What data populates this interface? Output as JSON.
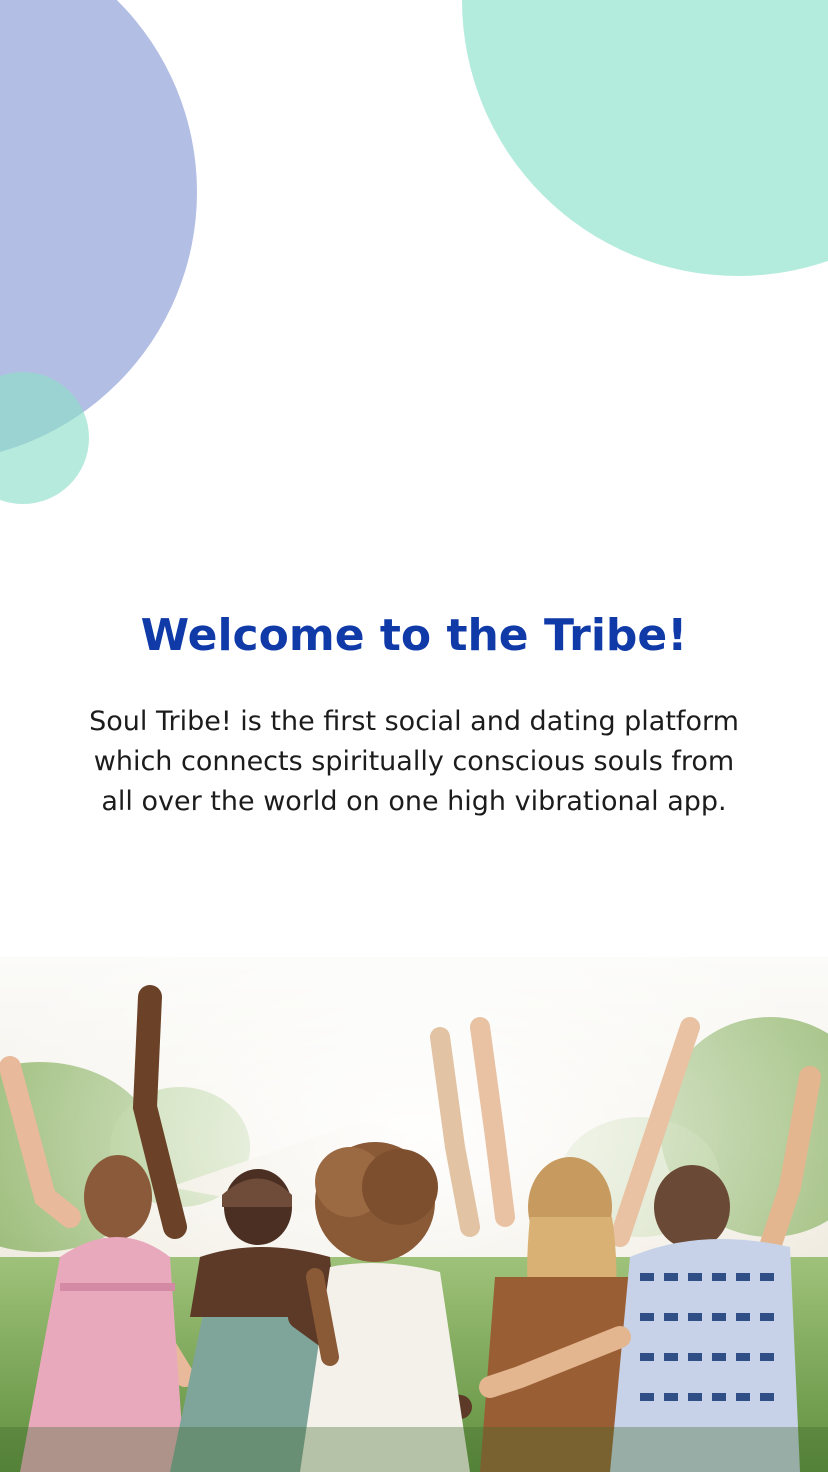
{
  "welcome": {
    "title": "Welcome to the Tribe!",
    "description": "Soul Tribe! is the first social and dating platform which connects spiritually conscious souls from all over the world on one high vibrational app."
  },
  "hero_image": {
    "subject": "group-of-friends-raising-arms-outdoors"
  },
  "colors": {
    "title": "#0f3aa8",
    "body_text": "#1c1c1c",
    "lavender": "#b3bee4",
    "mint": "#b3ecdc"
  }
}
